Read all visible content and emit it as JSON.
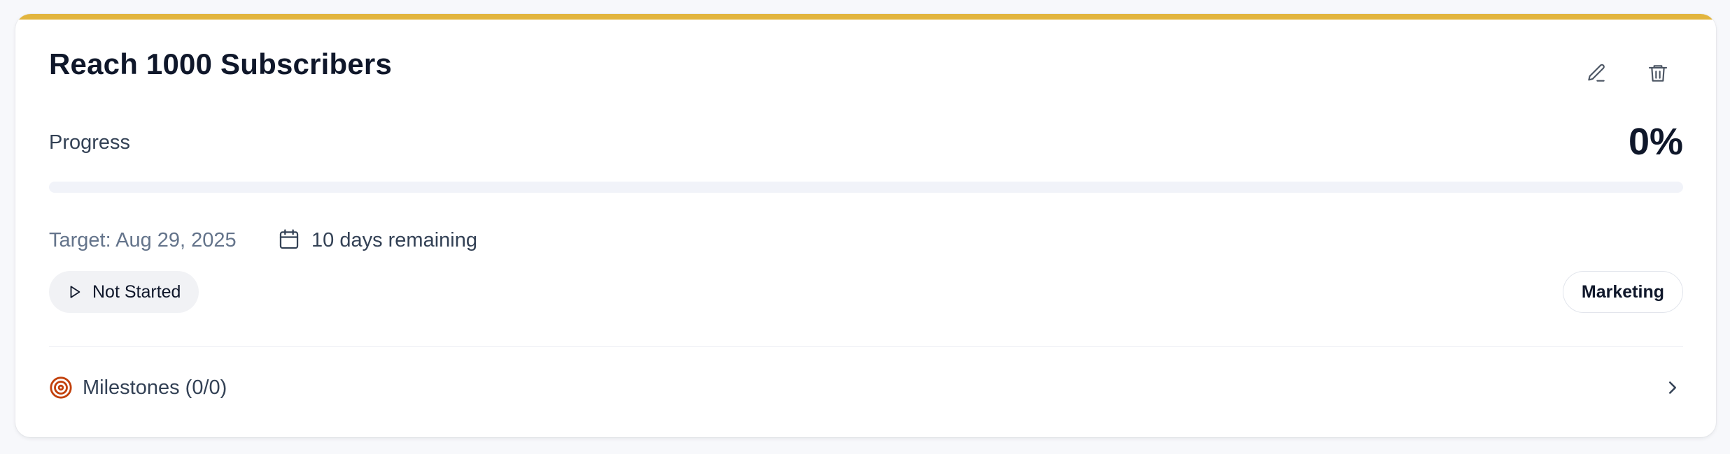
{
  "goal": {
    "title": "Reach 1000 Subscribers",
    "accent_color": "#e2b53e"
  },
  "actions": {
    "edit_icon": "pencil-icon",
    "delete_icon": "trash-icon"
  },
  "progress": {
    "label": "Progress",
    "value_text": "0%",
    "fraction": 0
  },
  "dates": {
    "target_text": "Target: Aug 29, 2025",
    "remaining_text": "10 days remaining",
    "icon": "calendar-icon"
  },
  "status": {
    "label": "Not Started",
    "icon": "play-icon"
  },
  "category": {
    "label": "Marketing"
  },
  "milestones": {
    "label": "Milestones (0/0)",
    "icon": "target-icon",
    "icon_color": "#c2410c",
    "expand_icon": "chevron-right-icon"
  }
}
